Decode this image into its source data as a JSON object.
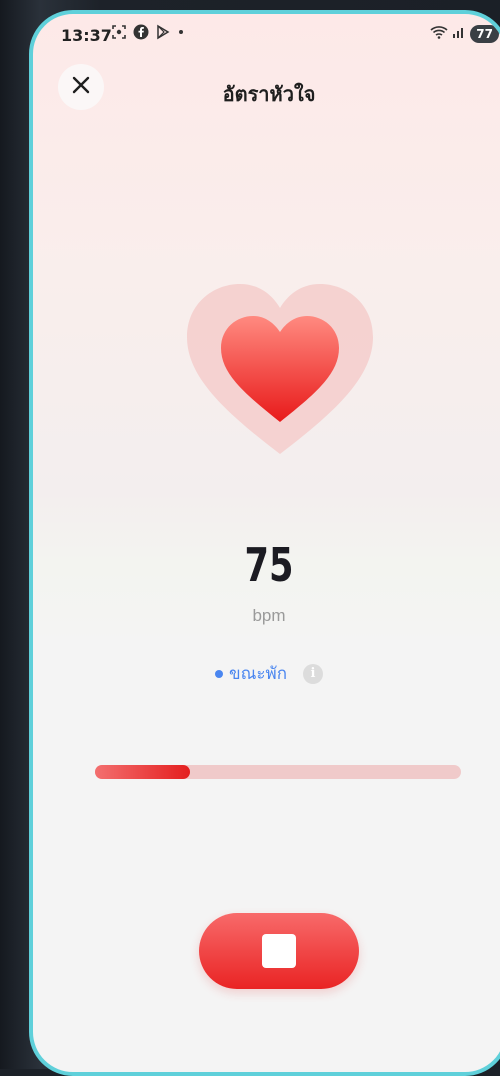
{
  "status_bar": {
    "time": "13:37",
    "battery": "77",
    "icons": [
      "screenshot-icon",
      "facebook-icon",
      "play-store-icon",
      "dot-icon",
      "wifi-icon",
      "signal-icon"
    ]
  },
  "header": {
    "title": "อัตราหัวใจ",
    "close_icon": "close-icon"
  },
  "measurement": {
    "value": "75",
    "unit": "bpm",
    "state_label": "ขณะพัก",
    "progress": 0.26
  },
  "colors": {
    "accent": "#e92424",
    "state_blue": "#4a86f0",
    "frame": "#5fd0da"
  },
  "controls": {
    "stop_icon": "stop-icon"
  }
}
